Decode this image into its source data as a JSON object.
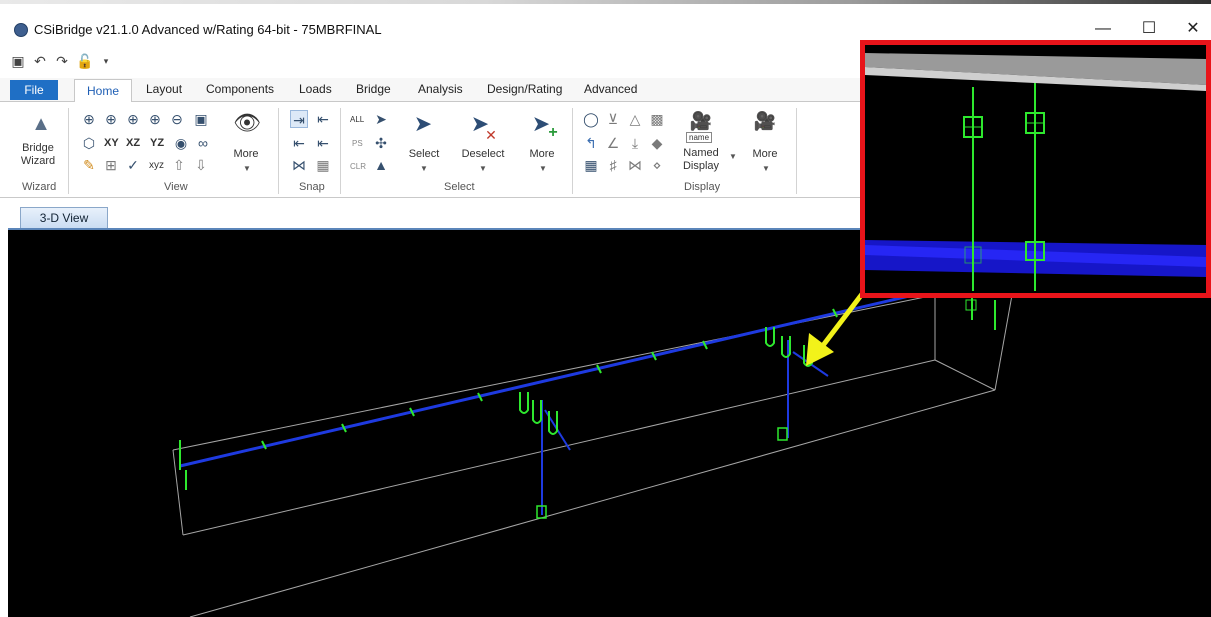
{
  "window": {
    "title": "CSiBridge v21.1.0 Advanced w/Rating 64-bit - 75MBRFINAL",
    "minimize_glyph": "—",
    "maximize_glyph": "☐",
    "close_glyph": "✕"
  },
  "quick_access": [
    "save-icon",
    "undo-icon",
    "redo-icon",
    "lock-icon",
    "customize-dropdown-icon"
  ],
  "tabs": {
    "file": "File",
    "items": [
      "Home",
      "Layout",
      "Components",
      "Loads",
      "Bridge",
      "Analysis",
      "Design/Rating",
      "Advanced"
    ],
    "active": "Home"
  },
  "ribbon": {
    "wizard": {
      "line1": "Bridge",
      "line2": "Wizard",
      "group": "Wizard"
    },
    "view": {
      "group": "View",
      "xy": "XY",
      "xz": "XZ",
      "yz": "YZ",
      "xyz": "xyz",
      "more": "More"
    },
    "snap": {
      "group": "Snap"
    },
    "select": {
      "group": "Select",
      "all": "ALL",
      "ps": "PS",
      "clr": "CLR",
      "select_label": "Select",
      "deselect_label": "Deselect",
      "more_label": "More"
    },
    "display": {
      "group": "Display",
      "name_box": "name",
      "named_line1": "Named",
      "named_line2": "Display",
      "more_label": "More"
    }
  },
  "view_tab": "3-D View",
  "colors": {
    "file_tab": "#1f6fc5",
    "inset_border": "#e8141a",
    "arrow": "#f2f21a",
    "frame_blue": "#1830d8",
    "section_green": "#2ee82e",
    "background": "#000000"
  }
}
